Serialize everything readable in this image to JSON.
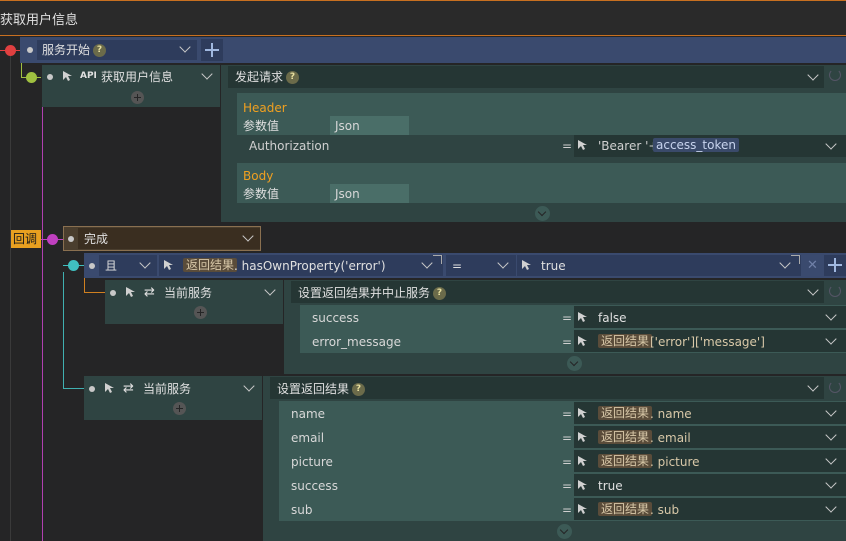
{
  "title": "获取用户信息",
  "service_start": {
    "label": "服务开始"
  },
  "api_node": {
    "badge": "API",
    "label": "获取用户信息",
    "action": "发起请求"
  },
  "request": {
    "header": {
      "section": "Header",
      "param_label": "参数值",
      "param_type": "Json",
      "row_key": "Authorization",
      "eq": "=",
      "value_prefix": "'Bearer '+",
      "value_var": "access_token"
    },
    "body": {
      "section": "Body",
      "param_label": "参数值",
      "param_type": "Json"
    }
  },
  "callback": {
    "tag": "回调",
    "label": "完成"
  },
  "condition": {
    "op": "且",
    "left_var": "返回结果",
    "left_method": ". hasOwnProperty('error')",
    "compare": "=",
    "right": "true"
  },
  "branch1": {
    "node": "当前服务",
    "action": "设置返回结果并中止服务",
    "rows": [
      {
        "key": "success",
        "eq": "=",
        "value": "false"
      },
      {
        "key": "error_message",
        "eq": "=",
        "var": "返回结果",
        "suffix": "['error']['message']"
      }
    ]
  },
  "branch2": {
    "node": "当前服务",
    "action": "设置返回结果",
    "rows": [
      {
        "key": "name",
        "eq": "=",
        "var": "返回结果",
        "suffix": ". name"
      },
      {
        "key": "email",
        "eq": "=",
        "var": "返回结果",
        "suffix": ". email"
      },
      {
        "key": "picture",
        "eq": "=",
        "var": "返回结果",
        "suffix": ". picture"
      },
      {
        "key": "success",
        "eq": "=",
        "value": "true"
      },
      {
        "key": "sub",
        "eq": "=",
        "var": "返回结果",
        "suffix": ". sub"
      }
    ]
  },
  "colors": {
    "accent_orange": "#f0a020",
    "start_red": "#e04040",
    "api_green": "#a0c040",
    "callback_magenta": "#c040c0",
    "cond_cyan": "#40c0c0"
  }
}
